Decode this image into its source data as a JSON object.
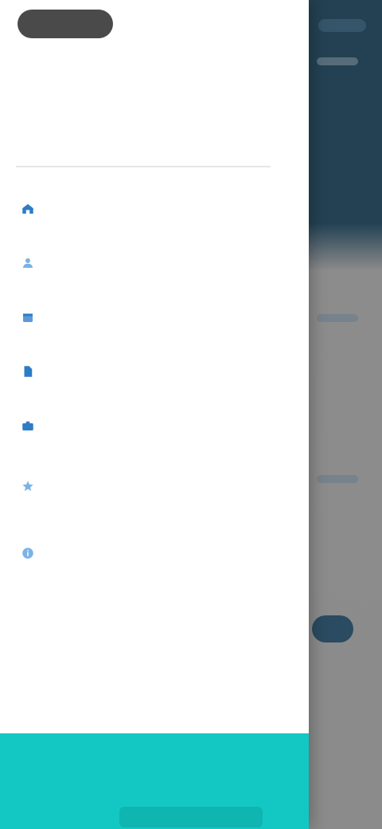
{
  "drawer": {
    "title": "",
    "handle_label": "",
    "search_placeholder": ""
  },
  "menu": [
    {
      "icon": "home-icon",
      "label": "",
      "sub": "",
      "icon_color": "#2e7cc6"
    },
    {
      "icon": "profile-icon",
      "label": "",
      "sub": "",
      "icon_color": "#7ab3e6"
    },
    {
      "icon": "calendar-icon",
      "label": "",
      "sub": "",
      "icon_color": "#5b9ad9"
    },
    {
      "icon": "document-icon",
      "label": "",
      "sub": "",
      "icon_color": "#2e7cc6"
    },
    {
      "icon": "briefcase-icon",
      "label": "",
      "sub": "",
      "icon_color": "#2e7cc6"
    },
    {
      "icon": "star-icon",
      "label": "",
      "sub": "",
      "icon_color": "#7ab3e6"
    },
    {
      "icon": "info-icon",
      "label": "",
      "sub": "",
      "icon_color": "#7ab3e6"
    }
  ],
  "bottom": {
    "text": "",
    "button_label": ""
  },
  "colors": {
    "accent": "#13c8c3",
    "header_bg": "#264459",
    "overlay": "#8b8b8b"
  }
}
